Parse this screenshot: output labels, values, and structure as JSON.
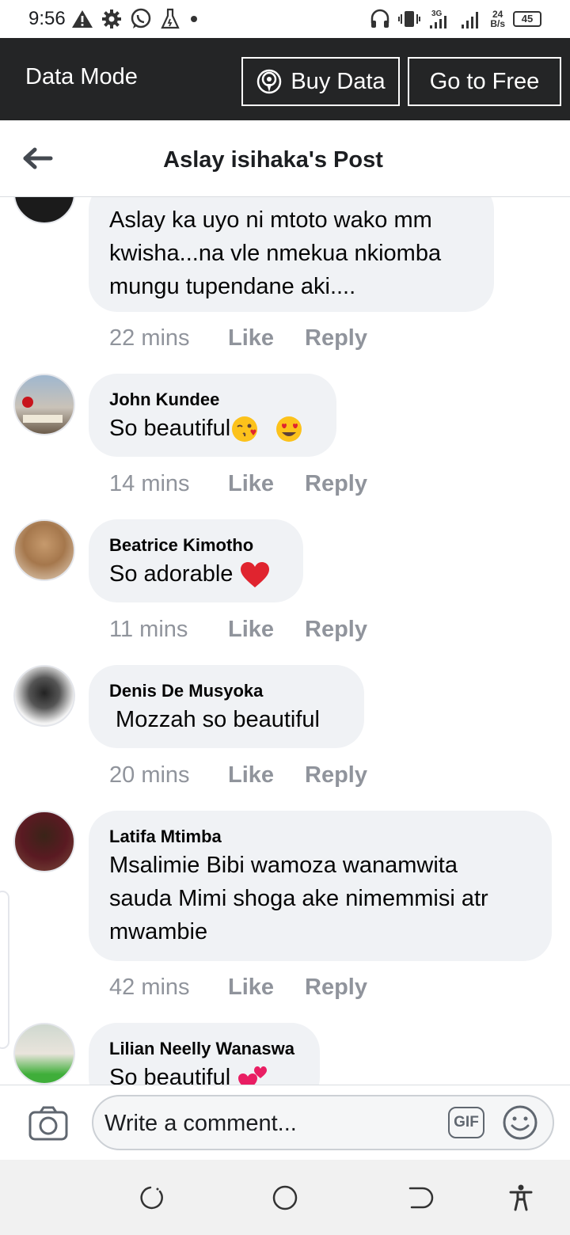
{
  "status_bar": {
    "time": "9:56",
    "network_speed": "24",
    "speed_unit": "B/s",
    "battery": "45",
    "icons_left": [
      "warning-icon",
      "gear-icon",
      "whatsapp-icon",
      "flask-icon",
      "dot-icon"
    ],
    "icons_right": [
      "headset-icon",
      "vibrate-icon",
      "signal-3g-icon",
      "signal-icon"
    ]
  },
  "data_mode": {
    "title": "Data Mode",
    "buy_label": "Buy Data",
    "free_label": "Go to Free"
  },
  "header": {
    "title": "Aslay isihaka's Post"
  },
  "comments": [
    {
      "name": "",
      "lines": [
        "Aslay ka uyo ni mtoto wako mm",
        "kwisha...na vle nmekua nkiomba",
        "mungu tupendane aki...."
      ],
      "time": "22 mins"
    },
    {
      "name": "John Kundee",
      "lines": [
        "So beautiful"
      ],
      "emoji": [
        "kissing-wink-emoji",
        "heart-eyes-emoji"
      ],
      "time": "14 mins"
    },
    {
      "name": "Beatrice Kimotho",
      "lines": [
        "So adorable "
      ],
      "emoji": [
        "red-heart-emoji"
      ],
      "time": "11 mins"
    },
    {
      "name": "Denis De Musyoka",
      "lines": [
        " Mozzah so beautiful"
      ],
      "time": "20 mins"
    },
    {
      "name": "Latifa Mtimba",
      "lines": [
        "Msalimie Bibi wamoza wanamwita",
        "sauda Mimi shoga ake nimemmisi atr",
        "mwambie"
      ],
      "time": "42 mins"
    },
    {
      "name": "Lilian Neelly Wanaswa",
      "lines": [
        "So beautiful "
      ],
      "emoji": [
        "two-hearts-emoji"
      ],
      "time": ""
    }
  ],
  "actions": {
    "like": "Like",
    "reply": "Reply"
  },
  "composer": {
    "placeholder": "Write a comment...",
    "gif_label": "GIF"
  },
  "nav": {
    "icons": [
      "recents-icon",
      "home-icon",
      "back-icon",
      "accessibility-icon"
    ]
  },
  "colors": {
    "data_bar": "#242526",
    "bubble": "#f0f2f5",
    "meta": "#90949c",
    "heart": "#e0242f",
    "emoji_yellow": "#fcc21b"
  }
}
